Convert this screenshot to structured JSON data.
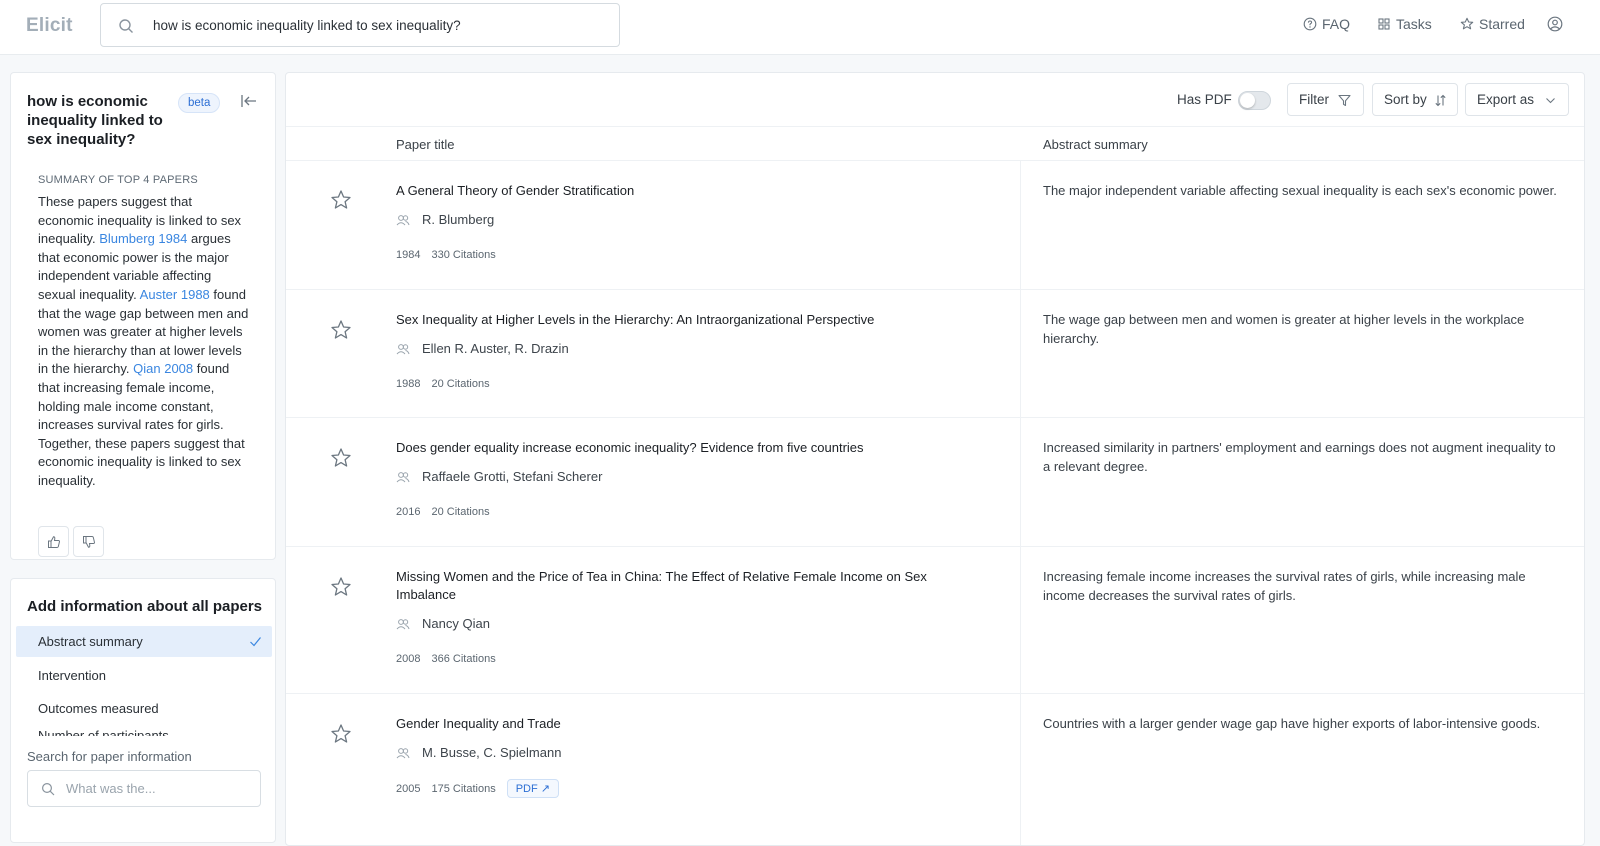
{
  "header": {
    "logo": "Elicit",
    "search_query": "how is economic inequality linked to sex inequality?",
    "nav": [
      {
        "label": "FAQ",
        "icon": "help-circle-icon"
      },
      {
        "label": "Tasks",
        "icon": "grid-icon"
      },
      {
        "label": "Starred",
        "icon": "star-icon"
      }
    ],
    "profile_icon": "user-circle-icon"
  },
  "sidebar": {
    "question": "how is economic inequality linked to sex inequality?",
    "badge": "beta",
    "summary_heading": "SUMMARY OF TOP 4 PAPERS",
    "summary": {
      "s1": "These papers suggest that economic inequality is linked to sex inequality. ",
      "l1": "Blumberg 1984",
      "s2": " argues that economic power is the major independent variable affecting sexual inequality. ",
      "l2": "Auster 1988",
      "s3": " found that the wage gap between men and women was greater at higher levels in the hierarchy than at lower levels in the hierarchy. ",
      "l3": "Qian 2008",
      "s4": " found that increasing female income, holding male income constant, increases survival rates for girls. Together, these papers suggest that economic inequality is linked to sex inequality."
    },
    "feedback_icons": [
      "thumbs-up-icon",
      "thumbs-down-icon"
    ]
  },
  "add_info": {
    "title": "Add information about all papers",
    "options": [
      {
        "label": "Abstract summary",
        "selected": true
      },
      {
        "label": "Intervention",
        "selected": false
      },
      {
        "label": "Outcomes measured",
        "selected": false
      },
      {
        "label": "Number of participants",
        "selected": false
      }
    ],
    "search_label": "Search for paper information",
    "search_placeholder": "What was the..."
  },
  "toolbar": {
    "has_pdf_label": "Has PDF",
    "has_pdf_on": false,
    "filter_label": "Filter",
    "sort_label": "Sort by",
    "export_label": "Export as"
  },
  "table": {
    "col_title": "Paper title",
    "col_abstract": "Abstract summary",
    "rows": [
      {
        "title": "A General Theory of Gender Stratification",
        "authors": "R. Blumberg",
        "year": "1984",
        "citations": "330 Citations",
        "pdf": "",
        "abstract": "The major independent variable affecting sexual inequality is each sex's economic power."
      },
      {
        "title": "Sex Inequality at Higher Levels in the Hierarchy: An Intraorganizational Perspective",
        "authors": "Ellen R. Auster, R. Drazin",
        "year": "1988",
        "citations": "20 Citations",
        "pdf": "",
        "abstract": "The wage gap between men and women is greater at higher levels in the workplace hierarchy."
      },
      {
        "title": "Does gender equality increase economic inequality? Evidence from five countries",
        "authors": "Raffaele Grotti, Stefani Scherer",
        "year": "2016",
        "citations": "20 Citations",
        "pdf": "",
        "abstract": "Increased similarity in partners' employment and earnings does not augment inequality to a relevant degree."
      },
      {
        "title": "Missing Women and the Price of Tea in China: The Effect of Relative Female Income on Sex Imbalance",
        "authors": "Nancy Qian",
        "year": "2008",
        "citations": "366 Citations",
        "pdf": "",
        "abstract": "Increasing female income increases the survival rates of girls, while increasing male income decreases the survival rates of girls."
      },
      {
        "title": "Gender Inequality and Trade",
        "authors": "M. Busse, C. Spielmann",
        "year": "2005",
        "citations": "175 Citations",
        "pdf": "PDF ↗",
        "abstract": "Countries with a larger gender wage gap have higher exports of labor-intensive goods."
      }
    ]
  },
  "colors": {
    "accent": "#3a86e0",
    "selected_bg": "#e4eefb",
    "border": "#e6eaee",
    "page_bg": "#f6f8fa"
  }
}
